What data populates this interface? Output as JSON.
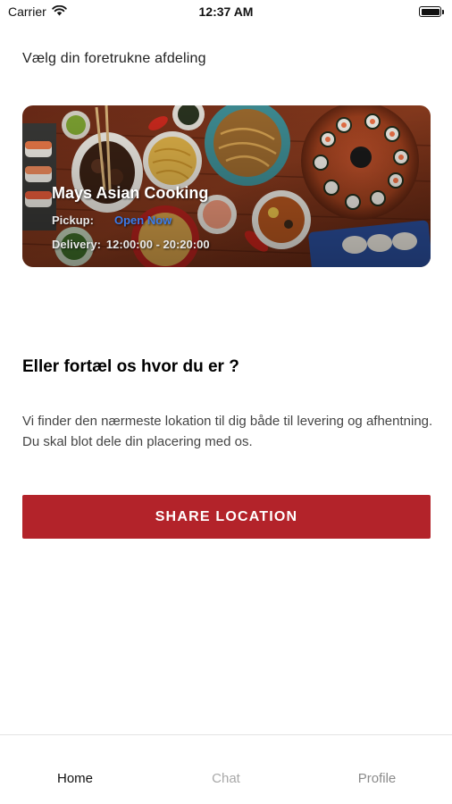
{
  "status_bar": {
    "carrier": "Carrier",
    "time": "12:37 AM",
    "icons": [
      "wifi-icon",
      "battery-icon"
    ]
  },
  "header": {
    "subtitle": "Vælg din foretrukne afdeling"
  },
  "store_card": {
    "name": "Mays Asian Cooking",
    "pickup_label": "Pickup:",
    "pickup_status": "Open Now",
    "pickup_status_color": "#3b7bea",
    "delivery_label": "Delivery:",
    "delivery_hours": "12:00:00 - 20:20:00"
  },
  "location": {
    "title": "Eller fortæl os hvor du er ?",
    "description": "Vi finder den nærmeste lokation til dig både til levering og afhentning. Du skal blot dele din placering med os.",
    "button_label": "SHARE LOCATION",
    "button_color": "#b3232a"
  },
  "tab_bar": {
    "tabs": [
      {
        "label": "Home",
        "active": true
      },
      {
        "label": "Chat",
        "active": false
      },
      {
        "label": "Profile",
        "active": false
      }
    ]
  }
}
